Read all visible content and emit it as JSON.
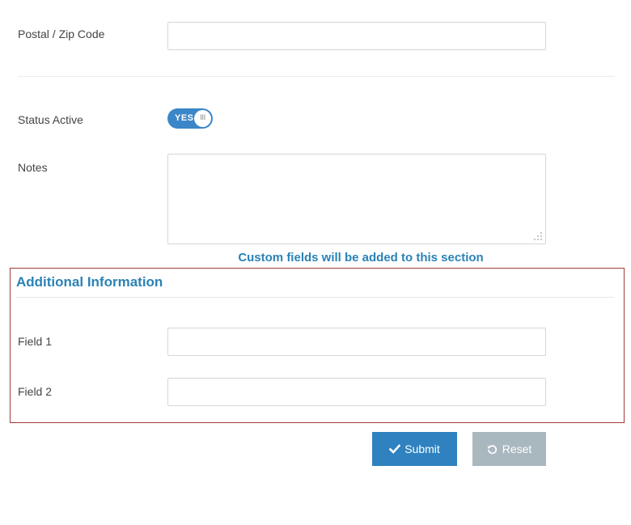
{
  "postal": {
    "label": "Postal / Zip Code",
    "value": "",
    "placeholder": ""
  },
  "status": {
    "label": "Status Active",
    "toggle_text": "YES",
    "toggle_knob_text": "III",
    "checked": true
  },
  "notes": {
    "label": "Notes",
    "value": "",
    "placeholder": ""
  },
  "custom_fields_note": "Custom fields will be added to this section",
  "additional": {
    "title": "Additional Information",
    "fields": [
      {
        "label": "Field 1",
        "value": "",
        "placeholder": ""
      },
      {
        "label": "Field 2",
        "value": "",
        "placeholder": ""
      }
    ]
  },
  "actions": {
    "submit_label": "Submit",
    "submit_icon": "check-icon",
    "reset_label": "Reset",
    "reset_icon": "rotate-left-icon"
  },
  "colors": {
    "accent": "#2f82bf",
    "section_title": "#2a82b6",
    "section_border": "#a33a3a",
    "reset_button": "#a9b7bf",
    "toggle_on": "#3a86c8"
  }
}
